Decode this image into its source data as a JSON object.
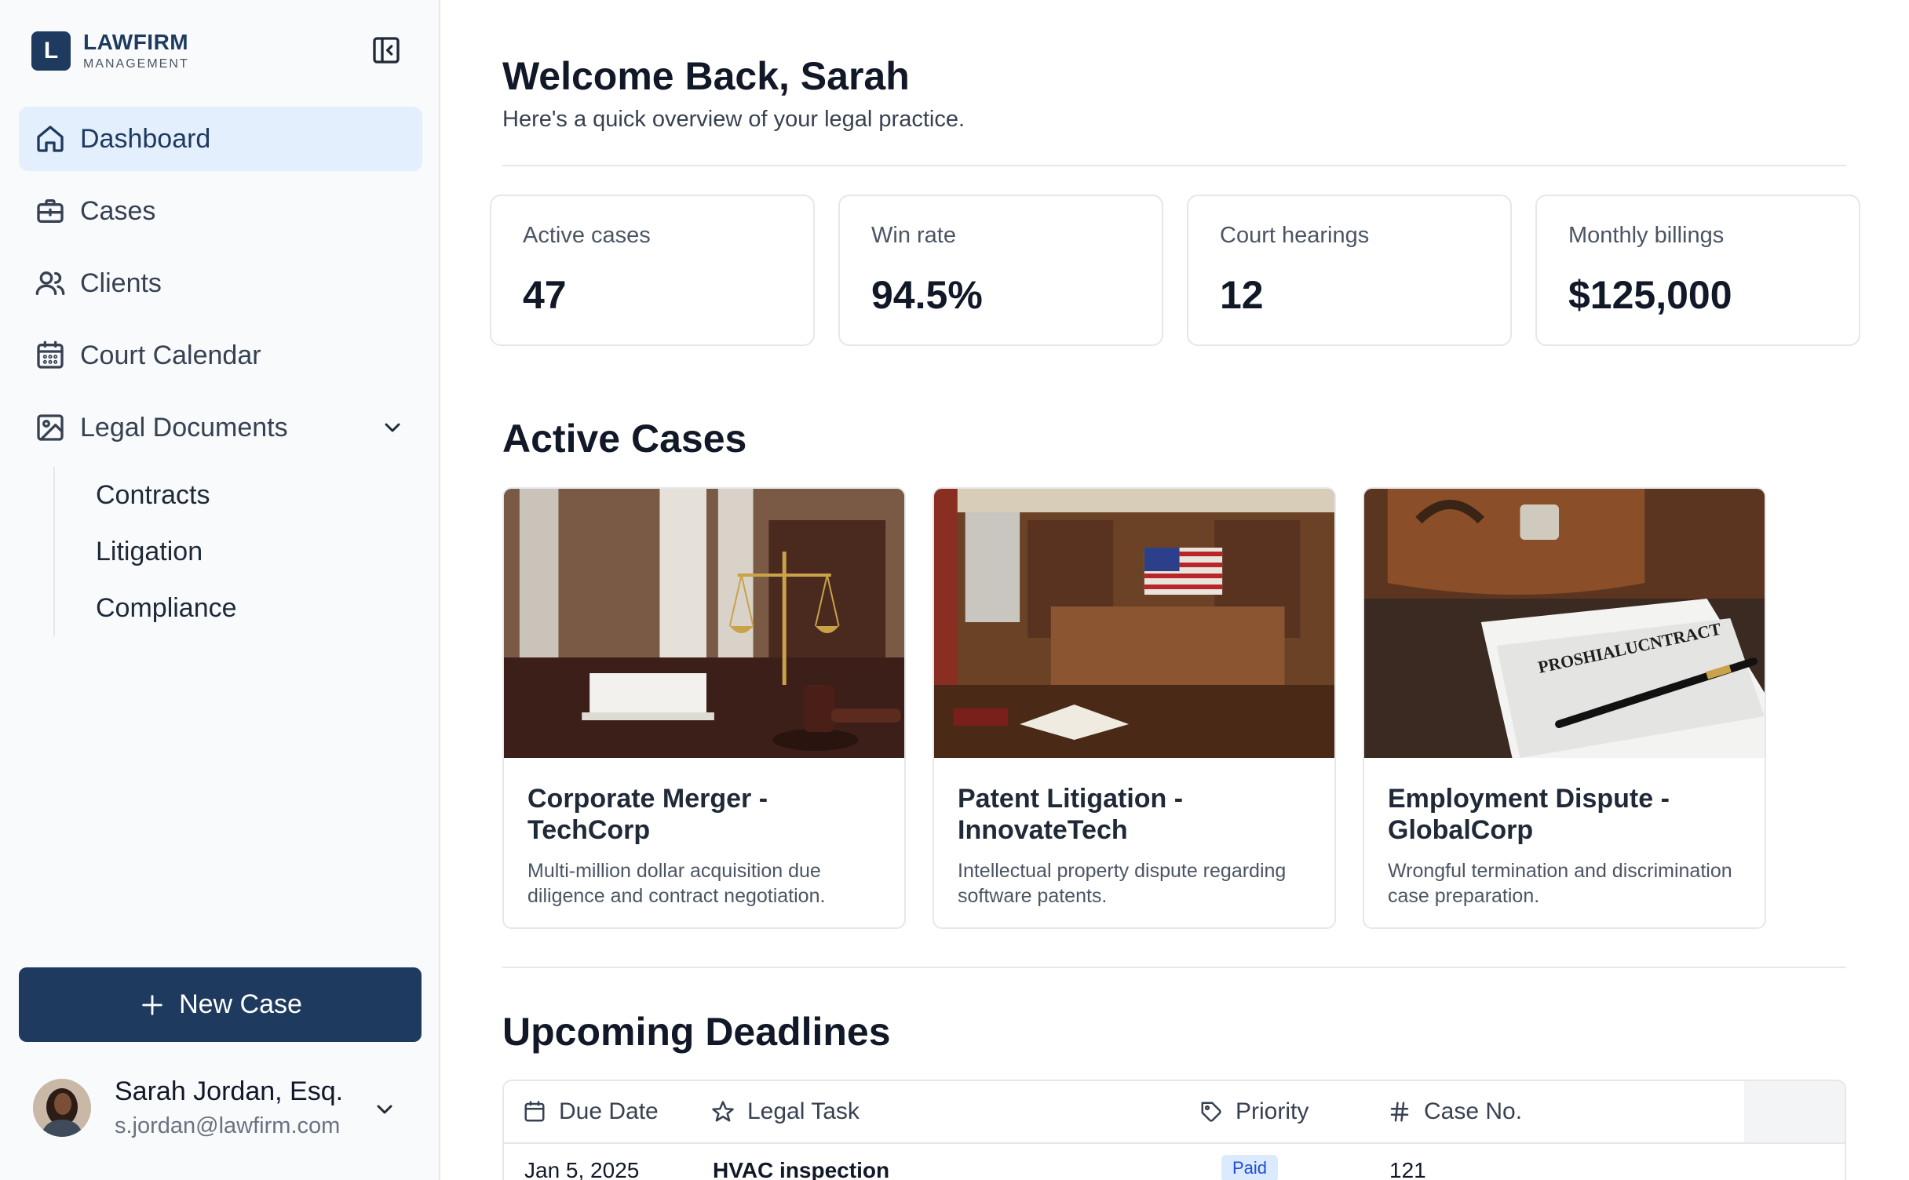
{
  "brand": {
    "letter": "L",
    "name": "LAWFIRM",
    "sub": "MANAGEMENT"
  },
  "nav": [
    {
      "label": "Dashboard",
      "icon": "home-icon",
      "active": true
    },
    {
      "label": "Cases",
      "icon": "briefcase-icon"
    },
    {
      "label": "Clients",
      "icon": "users-icon"
    },
    {
      "label": "Court Calendar",
      "icon": "calendar-icon"
    },
    {
      "label": "Legal Documents",
      "icon": "image-icon",
      "expanded": true
    }
  ],
  "subnav": [
    "Contracts",
    "Litigation",
    "Compliance"
  ],
  "new_case_label": "New Case",
  "user": {
    "name": "Sarah Jordan, Esq.",
    "email": "s.jordan@lawfirm.com"
  },
  "header": {
    "title": "Welcome Back, Sarah",
    "subtitle": "Here's a quick overview of your legal practice."
  },
  "stats": [
    {
      "label": "Active cases",
      "value": "47"
    },
    {
      "label": "Win rate",
      "value": "94.5%"
    },
    {
      "label": "Court hearings",
      "value": "12"
    },
    {
      "label": "Monthly billings",
      "value": "$125,000"
    }
  ],
  "active_cases": {
    "title": "Active Cases",
    "cards": [
      {
        "title": "Corporate Merger - TechCorp",
        "desc": "Multi-million dollar acquisition due diligence and contract negotiation.",
        "image": "scales-of-justice-gavel"
      },
      {
        "title": "Patent Litigation - InnovateTech",
        "desc": "Intellectual property dispute regarding software patents.",
        "image": "courtroom-flag"
      },
      {
        "title": "Employment Dispute - GlobalCorp",
        "desc": "Wrongful termination and discrimination case preparation.",
        "image": "briefcase-contract",
        "image_text": "PROSHIALUCNTRACT"
      }
    ]
  },
  "deadlines": {
    "title": "Upcoming Deadlines",
    "columns": [
      "Due Date",
      "Legal Task",
      "Priority",
      "Case No."
    ],
    "rows": [
      {
        "due": "Jan 5, 2025",
        "task": "HVAC inspection",
        "priority": "Paid",
        "case_no": "121",
        "more": "..."
      }
    ]
  },
  "colors": {
    "primary": "#1e3a5f",
    "active_bg": "#e3effc",
    "border": "#e5e7eb"
  }
}
